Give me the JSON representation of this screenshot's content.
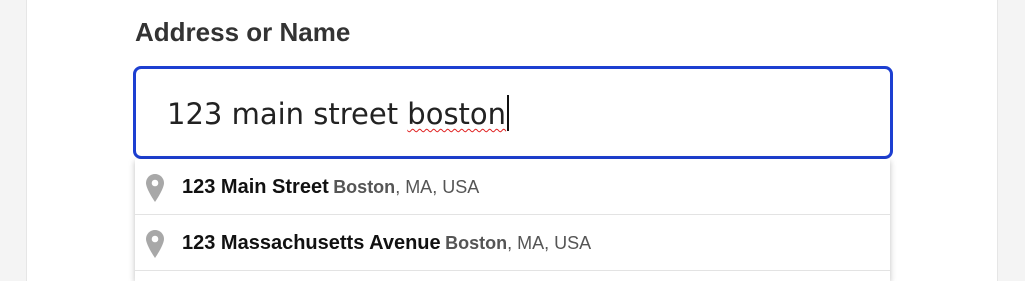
{
  "form": {
    "label": "Address or Name",
    "input": {
      "value_plain": "123 main street ",
      "value_misspelled": "boston"
    },
    "accent_color": "#1d3fd1"
  },
  "suggestions": [
    {
      "icon": "map-pin-icon",
      "main": "123 Main Street",
      "city": "Boston",
      "rest": ", MA, USA"
    },
    {
      "icon": "map-pin-icon",
      "main": "123 Massachusetts Avenue",
      "city": "Boston",
      "rest": ", MA, USA"
    }
  ]
}
